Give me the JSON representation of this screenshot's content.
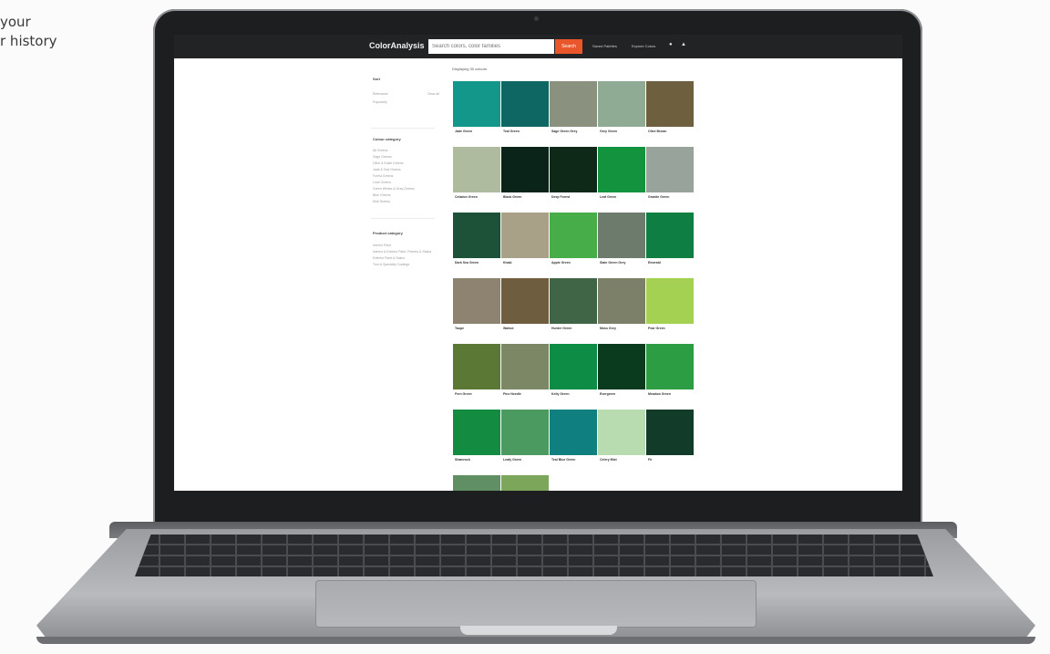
{
  "promo": {
    "line1": "your",
    "line2": "r history"
  },
  "app": {
    "logo": "ColorAnalysis",
    "search_placeholder": "Search colors, color families",
    "search_button": "Search",
    "nav": [
      "Saved Palettes",
      "Explore Colors"
    ],
    "icons": [
      "user-icon",
      "cart-icon"
    ]
  },
  "sidebar": {
    "sort_heading": "Sort",
    "sort_options": [
      "Relevance",
      "Popularity"
    ],
    "sort_link": "Clear all",
    "color_heading": "Colour category",
    "color_items": [
      "All Greens",
      "Sage Greens",
      "Olive & Khaki Greens",
      "Jade & Teal Greens",
      "Forest Greens",
      "Lime Greens",
      "Green Whites & Grey-Greens",
      "Blue Greens",
      "Mint Greens"
    ],
    "product_heading": "Product category",
    "product_items": [
      "Interior Paint",
      "Interior & Exterior Paint, Primers & Stains",
      "Exterior Paint & Stains",
      "Trim & Specialty Coatings"
    ]
  },
  "results": {
    "title": "Displaying 30 colours",
    "colors": [
      {
        "name": "Jade Green",
        "hex": "#13978b"
      },
      {
        "name": "Teal Green",
        "hex": "#0e6762"
      },
      {
        "name": "Sage Green Grey",
        "hex": "#8b917f"
      },
      {
        "name": "Grey Green",
        "hex": "#8fab93"
      },
      {
        "name": "Olive Brown",
        "hex": "#6e5f3f"
      },
      {
        "name": "Celadon Green",
        "hex": "#aebb9f"
      },
      {
        "name": "Black Green",
        "hex": "#0b241a"
      },
      {
        "name": "Deep Forest",
        "hex": "#0f2918"
      },
      {
        "name": "Leaf Green",
        "hex": "#14933f"
      },
      {
        "name": "Granite Green",
        "hex": "#98a39b"
      },
      {
        "name": "Dark Sea Green",
        "hex": "#1d5138"
      },
      {
        "name": "Khaki",
        "hex": "#a9a088"
      },
      {
        "name": "Apple Green",
        "hex": "#47ad48"
      },
      {
        "name": "Slate Green Grey",
        "hex": "#6d7b6c"
      },
      {
        "name": "Emerald",
        "hex": "#0f7e42"
      },
      {
        "name": "Taupe",
        "hex": "#8e8270"
      },
      {
        "name": "Walnut",
        "hex": "#6e5d3f"
      },
      {
        "name": "Hunter Green",
        "hex": "#3f6546"
      },
      {
        "name": "Moss Grey",
        "hex": "#7d8068"
      },
      {
        "name": "Pear Green",
        "hex": "#a5d152"
      },
      {
        "name": "Fern Green",
        "hex": "#5b7935"
      },
      {
        "name": "Pine Needle",
        "hex": "#7b8765"
      },
      {
        "name": "Kelly Green",
        "hex": "#0c8c45"
      },
      {
        "name": "Evergreen",
        "hex": "#0a3b1f"
      },
      {
        "name": "Meadow Green",
        "hex": "#2d9d44"
      },
      {
        "name": "Shamrock",
        "hex": "#138c42"
      },
      {
        "name": "Leafy Green",
        "hex": "#4b9a5f"
      },
      {
        "name": "Teal Blue Green",
        "hex": "#0f7f7f"
      },
      {
        "name": "Celery Mist",
        "hex": "#b8dcaf"
      },
      {
        "name": "Fir",
        "hex": "#123c29"
      },
      {
        "name": "",
        "hex": "#5f8f63"
      },
      {
        "name": "",
        "hex": "#7ca75a"
      }
    ]
  }
}
